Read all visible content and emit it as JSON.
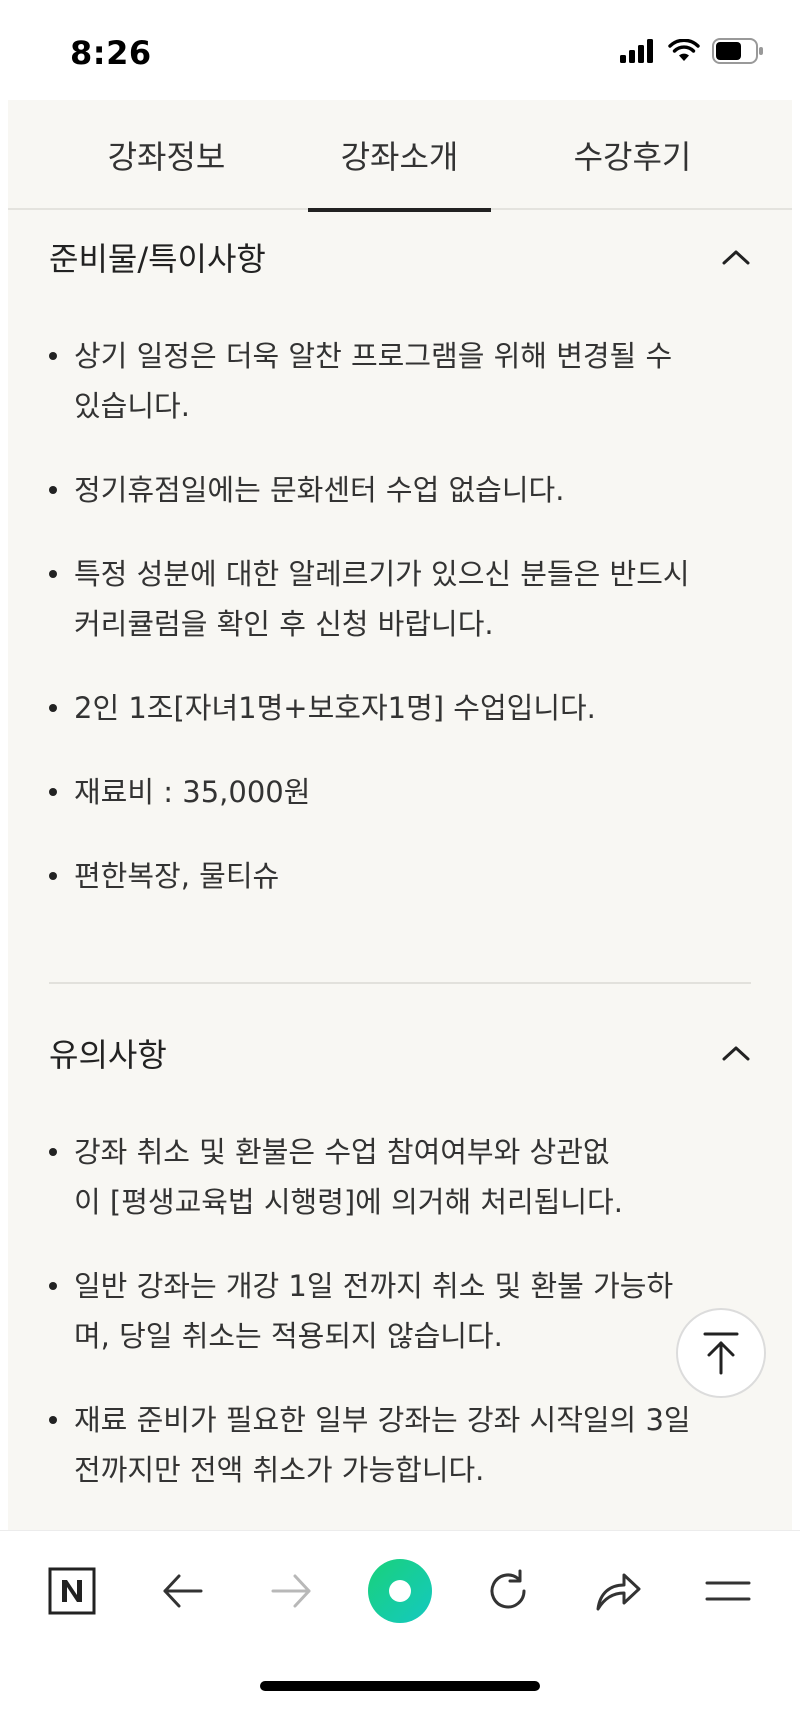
{
  "status_bar": {
    "time": "8:26",
    "battery_level": 0.65
  },
  "tabs": [
    {
      "label": "강좌정보",
      "active": false
    },
    {
      "label": "강좌소개",
      "active": true
    },
    {
      "label": "수강후기",
      "active": false
    }
  ],
  "sections": [
    {
      "title": "준비물/특이사항",
      "expanded": true,
      "items": [
        "상기 일정은 더욱 알찬 프로그램을 위해 변경될 수 있습니다.",
        "정기휴점일에는 문화센터 수업 없습니다.",
        "특정 성분에 대한 알레르기가 있으신 분들은 반드시 커리큘럼을 확인 후 신청 바랍니다.",
        "2인 1조[자녀1명+보호자1명] 수업입니다.",
        "재료비 : 35,000원",
        "편한복장, 물티슈"
      ]
    },
    {
      "title": "유의사항",
      "expanded": true,
      "items": [
        "강좌 취소 및 환불은 수업 참여여부와 상관없이 [평생교육법 시행령]에 의거해 처리됩니다.",
        "일반 강좌는 개강 1일 전까지 취소 및 환불 가능하며, 당일 취소는 적용되지 않습니다.",
        "재료 준비가 필요한 일부 강좌는 강좌 시작일의 3일 전까지만 전액 취소가 가능합니다."
      ]
    }
  ],
  "icons": {
    "chevron": "chevron-up-icon",
    "scroll_top": "arrow-up-to-line-icon",
    "toolbar": [
      "naver-n-icon",
      "back-arrow-icon",
      "forward-arrow-icon",
      "green-dot-icon",
      "reload-icon",
      "share-icon",
      "menu-icon"
    ]
  },
  "colors": {
    "panel_bg": "#f8f7f3",
    "accent_green": "#19d17a",
    "accent_teal": "#14c9c1",
    "text": "#333333"
  }
}
